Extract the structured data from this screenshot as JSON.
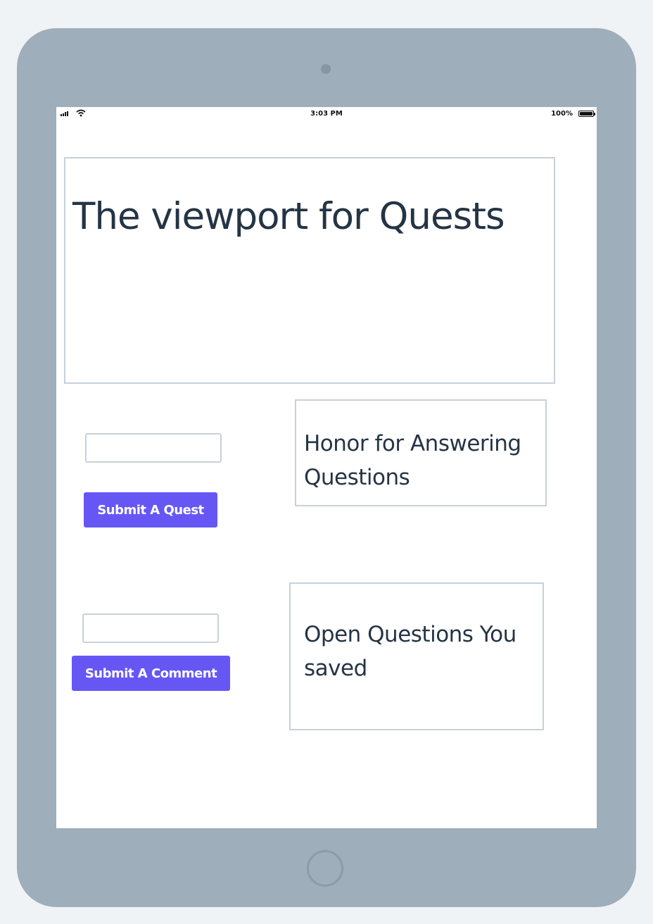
{
  "status_bar": {
    "time": "3:03 PM",
    "battery_percent": "100%",
    "icons": [
      "signal-icon",
      "wifi-icon",
      "battery-icon"
    ]
  },
  "viewport": {
    "title": "The viewport for Quests"
  },
  "quest_form": {
    "input_value": "",
    "button_label": "Submit A Quest"
  },
  "comment_form": {
    "input_value": "",
    "button_label": "Submit A Comment"
  },
  "panels": {
    "honor_label": "Honor for Answering Questions",
    "saved_label": "Open Questions You saved"
  },
  "colors": {
    "device_frame": "#9eaeba",
    "button": "#6657f5",
    "text": "#253445",
    "border": "#c7d1d9"
  }
}
